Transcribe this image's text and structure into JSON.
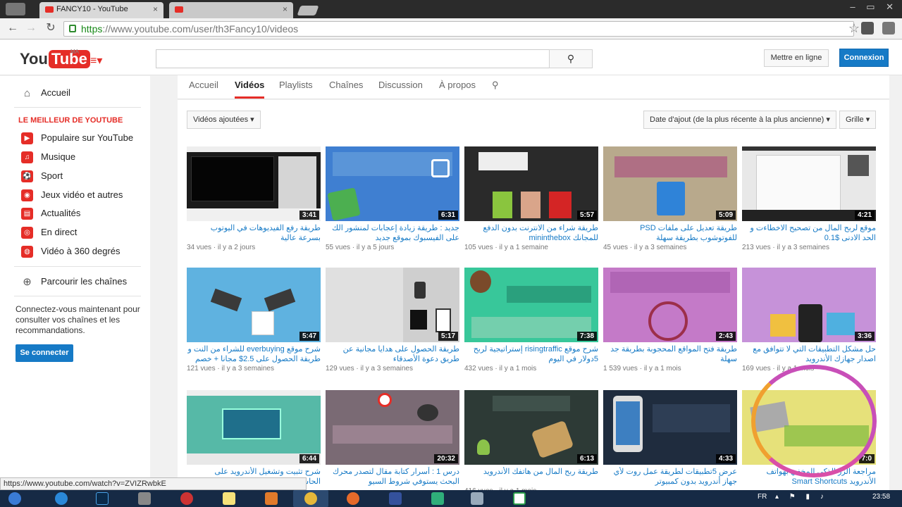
{
  "browser": {
    "tabs": [
      {
        "title": "FANCY10 - YouTube"
      },
      {
        "title": ""
      }
    ],
    "url": {
      "https": "https",
      "rest": "://www.youtube.com/user/th3Fancy10/videos"
    }
  },
  "header": {
    "logo_you": "You",
    "logo_tube": "Tube",
    "logo_region": "MA",
    "upload_label": "Mettre en ligne",
    "signin_label": "Connexion"
  },
  "sidebar": {
    "home": "Accueil",
    "heading": "LE MEILLEUR DE YOUTUBE",
    "items": [
      {
        "label": "Populaire sur YouTube",
        "icon": "popular-icon"
      },
      {
        "label": "Musique",
        "icon": "music-icon"
      },
      {
        "label": "Sport",
        "icon": "sport-icon"
      },
      {
        "label": "Jeux vidéo et autres",
        "icon": "gaming-icon"
      },
      {
        "label": "Actualités",
        "icon": "news-icon"
      },
      {
        "label": "En direct",
        "icon": "live-icon"
      },
      {
        "label": "Vidéo à 360 degrés",
        "icon": "360-icon"
      }
    ],
    "browse": "Parcourir les chaînes",
    "promo": "Connectez-vous maintenant pour consulter vos chaînes et les recommandations.",
    "signin": "Se connecter"
  },
  "channel_tabs": [
    "Accueil",
    "Vidéos",
    "Playlists",
    "Chaînes",
    "Discussion",
    "À propos"
  ],
  "filters": {
    "uploads": "Vidéos ajoutées ▾",
    "sort": "Date d'ajout (de la plus récente à la plus ancienne) ▾",
    "view": "Grille ▾"
  },
  "videos": [
    {
      "title": "طريقة رفع الفيديوهات في اليوتوب بسرعة عالية",
      "views": "34 vues",
      "age": "il y a 2 jours",
      "duration": "3:41"
    },
    {
      "title": "جديد : طريقة زيادة إعجابات لمنشور الك على الفيسبوك بموقع جديد",
      "views": "55 vues",
      "age": "il y a 5 jours",
      "duration": "6:31"
    },
    {
      "title": "طريقة شراء من الانترنت بدون الدفع للمجانك mininthebox",
      "views": "105 vues",
      "age": "il y a 1 semaine",
      "duration": "5:57"
    },
    {
      "title": "طريقة تعديل على ملفات PSD للفوتوشوب بطريقة سهلة",
      "views": "45 vues",
      "age": "il y a 3 semaines",
      "duration": "5:09"
    },
    {
      "title": "موقع لربح المال من تصحيح الاخطاءت و الحد الادنى $0.1",
      "views": "213 vues",
      "age": "il y a 3 semaines",
      "duration": "4:21"
    },
    {
      "title": "شرح موقع everbuying للشراء من النت و طريقة الحصول على 2.5$ مجانا + خصم",
      "views": "121 vues",
      "age": "il y a 3 semaines",
      "duration": "5:47"
    },
    {
      "title": "طريقة الحصول على هدايا مجانية عن طريق دعوة الأصدقاء",
      "views": "129 vues",
      "age": "il y a 3 semaines",
      "duration": "5:17"
    },
    {
      "title": "شرح موقع risingtraffic إستراتيجية لربح 5دولار في اليوم",
      "views": "432 vues",
      "age": "il y a 1 mois",
      "duration": "7:38"
    },
    {
      "title": "طريقة فتح المواقع المحجوبة بطريقة جد سهلة",
      "views": "1 539 vues",
      "age": "il y a 1 mois",
      "duration": "2:43"
    },
    {
      "title": "حل مشكل التطبيقات التي لا تتوافق مع اصدار جهازك الأندرويد",
      "views": "169 vues",
      "age": "il y a 1 mois",
      "duration": "3:36"
    },
    {
      "title": "شرح تثبيت وتشغيل الأندرويد على الحاسوب",
      "views": "",
      "age": "",
      "duration": "6:44"
    },
    {
      "title": "درس 1 : أسرار كتابة مقال لتصدر محرك البحث يستوفي شروط السيو",
      "views": "",
      "age": "",
      "duration": "20:32"
    },
    {
      "title": "طريقة ربح المال من هاتفك الأندرويد",
      "views": "416 vues",
      "age": "il y a 1 mois",
      "duration": "6:13"
    },
    {
      "title": "عرض 5تطبيقات لطريقة عمل روت لأي جهاز أندرويد بدون كمبيوتر",
      "views": "",
      "age": "",
      "duration": "4:33"
    },
    {
      "title": "مراجعة الزر الذكي المخفي بهواتف الأندرويد Smart Shortcuts",
      "views": "",
      "age": "",
      "duration": "7:0"
    }
  ],
  "status_url": "https://www.youtube.com/watch?v=ZVIZRwbkE",
  "taskbar": {
    "lang": "FR",
    "time": "23:58"
  },
  "colors": {
    "brand_red": "#e52d27",
    "link_blue": "#167ac6",
    "signin_blue": "#167ac6"
  }
}
